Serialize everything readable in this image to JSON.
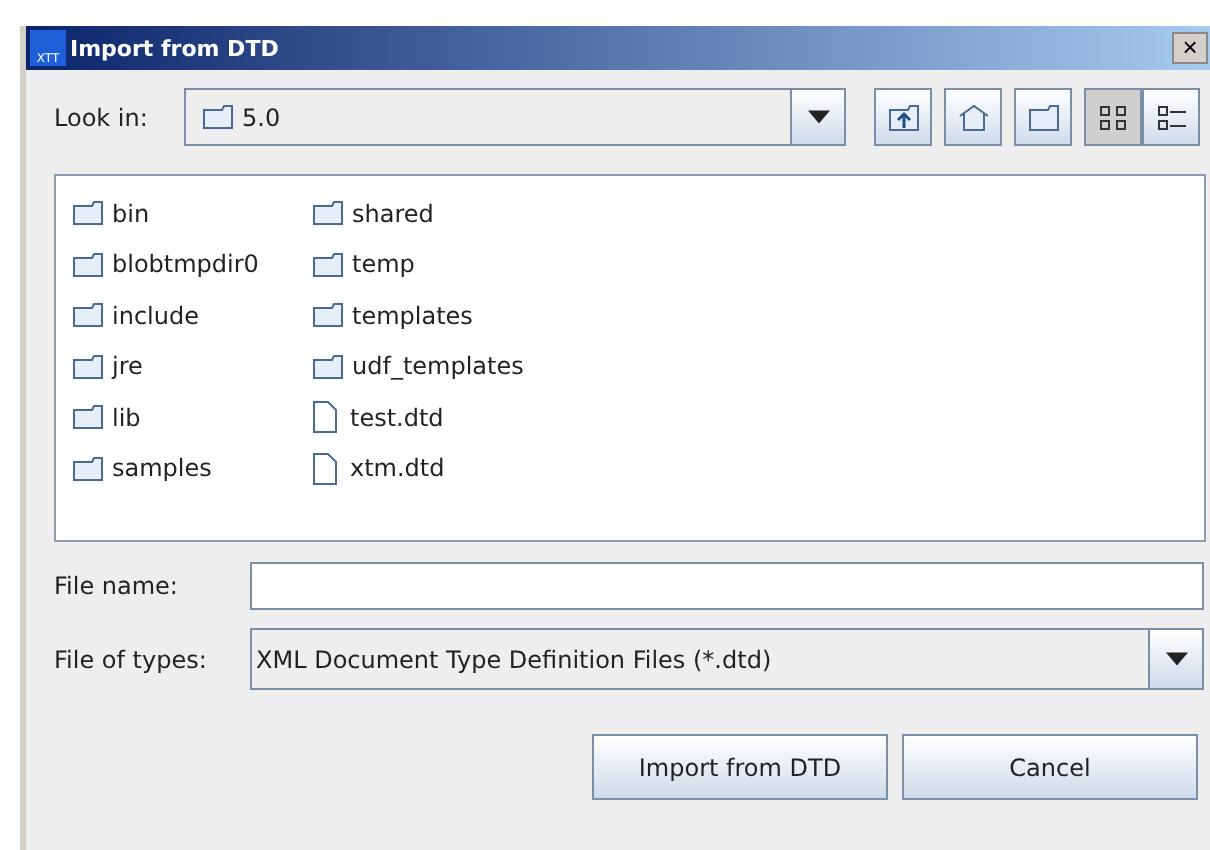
{
  "window": {
    "title": "Import from DTD",
    "app_icon_text": "XTT",
    "close": "×"
  },
  "look_in": {
    "label": "Look in:",
    "value": "5.0"
  },
  "toolbar": [
    {
      "kind": "up",
      "selected": false
    },
    {
      "kind": "home",
      "selected": false
    },
    {
      "kind": "new-folder",
      "selected": false
    },
    {
      "kind": "list",
      "selected": true
    },
    {
      "kind": "details",
      "selected": false
    }
  ],
  "files": [
    {
      "name": "bin",
      "kind": "folder"
    },
    {
      "name": "blobtmpdir0",
      "kind": "folder"
    },
    {
      "name": "include",
      "kind": "folder"
    },
    {
      "name": "jre",
      "kind": "folder"
    },
    {
      "name": "lib",
      "kind": "folder"
    },
    {
      "name": "samples",
      "kind": "folder"
    },
    {
      "name": "shared",
      "kind": "folder"
    },
    {
      "name": "temp",
      "kind": "folder"
    },
    {
      "name": "templates",
      "kind": "folder"
    },
    {
      "name": "udf_templates",
      "kind": "folder"
    },
    {
      "name": "test.dtd",
      "kind": "file"
    },
    {
      "name": "xtm.dtd",
      "kind": "file"
    }
  ],
  "file_name": {
    "label": "File name:"
  },
  "file_types": {
    "label": "File of types:",
    "value": "XML Document Type Definition Files (*.dtd)"
  },
  "buttons": [
    "Import from DTD",
    "Cancel"
  ]
}
